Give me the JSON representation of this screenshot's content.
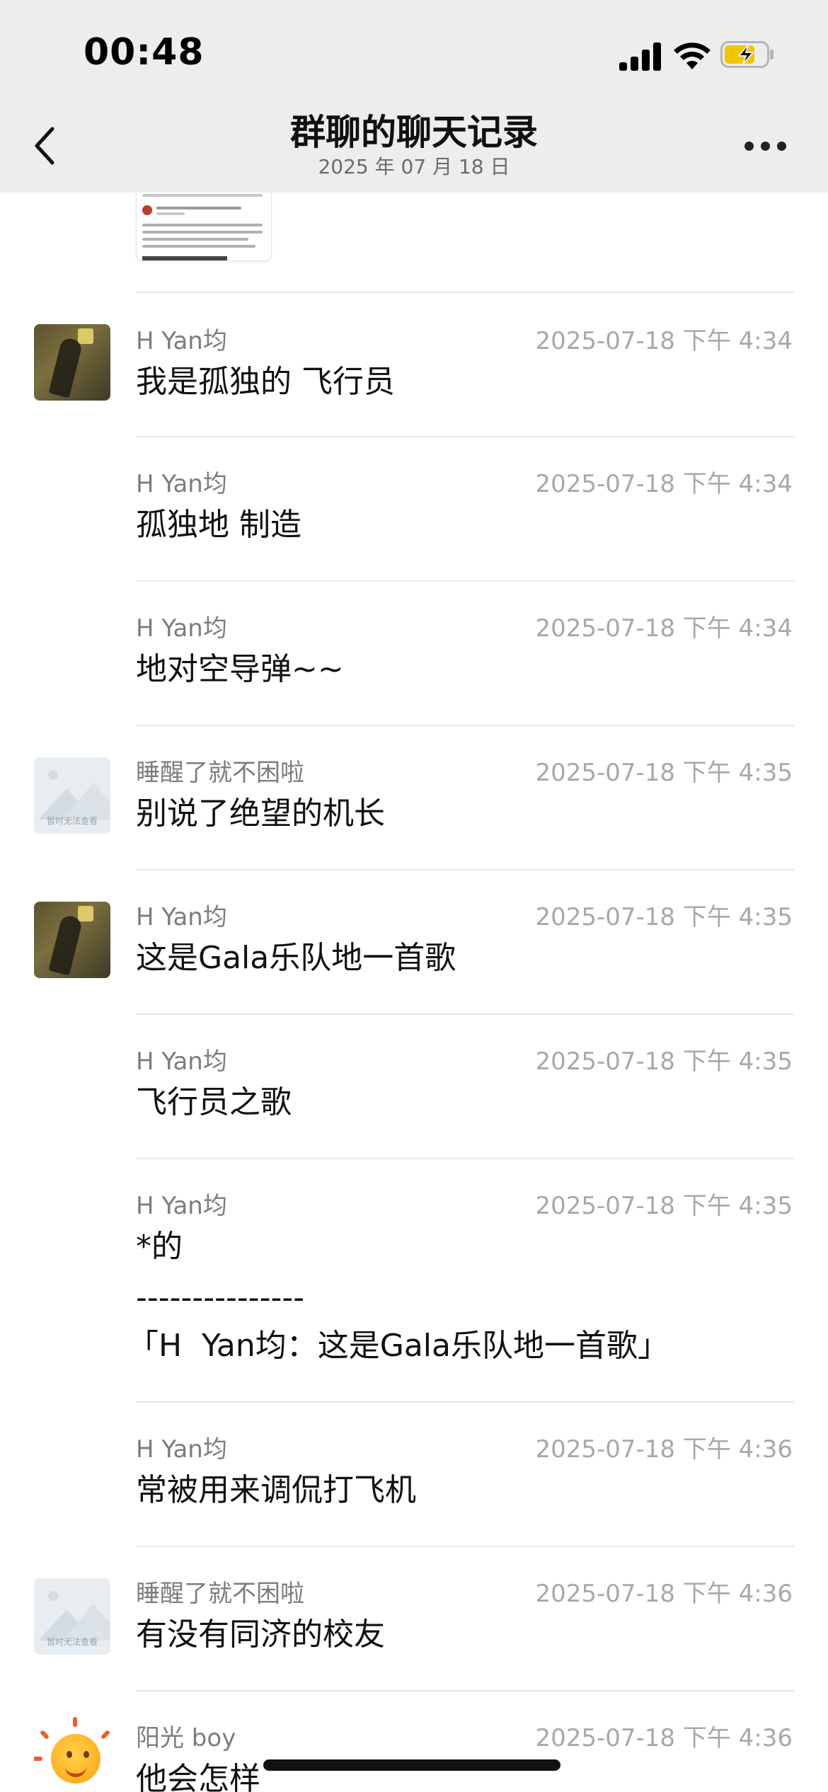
{
  "status_bar": {
    "time": "00:48"
  },
  "header": {
    "title": "群聊的聊天记录",
    "subtitle": "2025 年 07 月 18 日"
  },
  "messages": [
    {
      "sender": "H  Yan均",
      "time": "2025-07-18 下午 4:34",
      "text": "我是孤独的 飞行员",
      "avatar": "photo-avatar"
    },
    {
      "sender": "H  Yan均",
      "time": "2025-07-18 下午 4:34",
      "text": "孤独地 制造"
    },
    {
      "sender": "H  Yan均",
      "time": "2025-07-18 下午 4:34",
      "text": "地对空导弹~~"
    },
    {
      "sender": "睡醒了就不困啦",
      "time": "2025-07-18 下午 4:35",
      "text": "别说了绝望的机长",
      "avatar": "placeholder-avatar",
      "avatar_text": "暂时无法查看"
    },
    {
      "sender": "H  Yan均",
      "time": "2025-07-18 下午 4:35",
      "text": "这是Gala乐队地一首歌",
      "avatar": "photo-avatar"
    },
    {
      "sender": "H  Yan均",
      "time": "2025-07-18 下午 4:35",
      "text": "飞行员之歌"
    },
    {
      "sender": "H  Yan均",
      "time": "2025-07-18 下午 4:35",
      "text": "*的",
      "separator": "---------------",
      "quote": "「H  Yan均：这是Gala乐队地一首歌」"
    },
    {
      "sender": "H  Yan均",
      "time": "2025-07-18 下午 4:36",
      "text": "常被用来调侃打飞机"
    },
    {
      "sender": "睡醒了就不困啦",
      "time": "2025-07-18 下午 4:36",
      "text": "有没有同济的校友",
      "avatar": "placeholder-avatar",
      "avatar_text": "暂时无法查看"
    },
    {
      "sender": "阳光 boy",
      "time": "2025-07-18 下午 4:36",
      "text": "他会怎样",
      "avatar": "sun-avatar"
    }
  ]
}
